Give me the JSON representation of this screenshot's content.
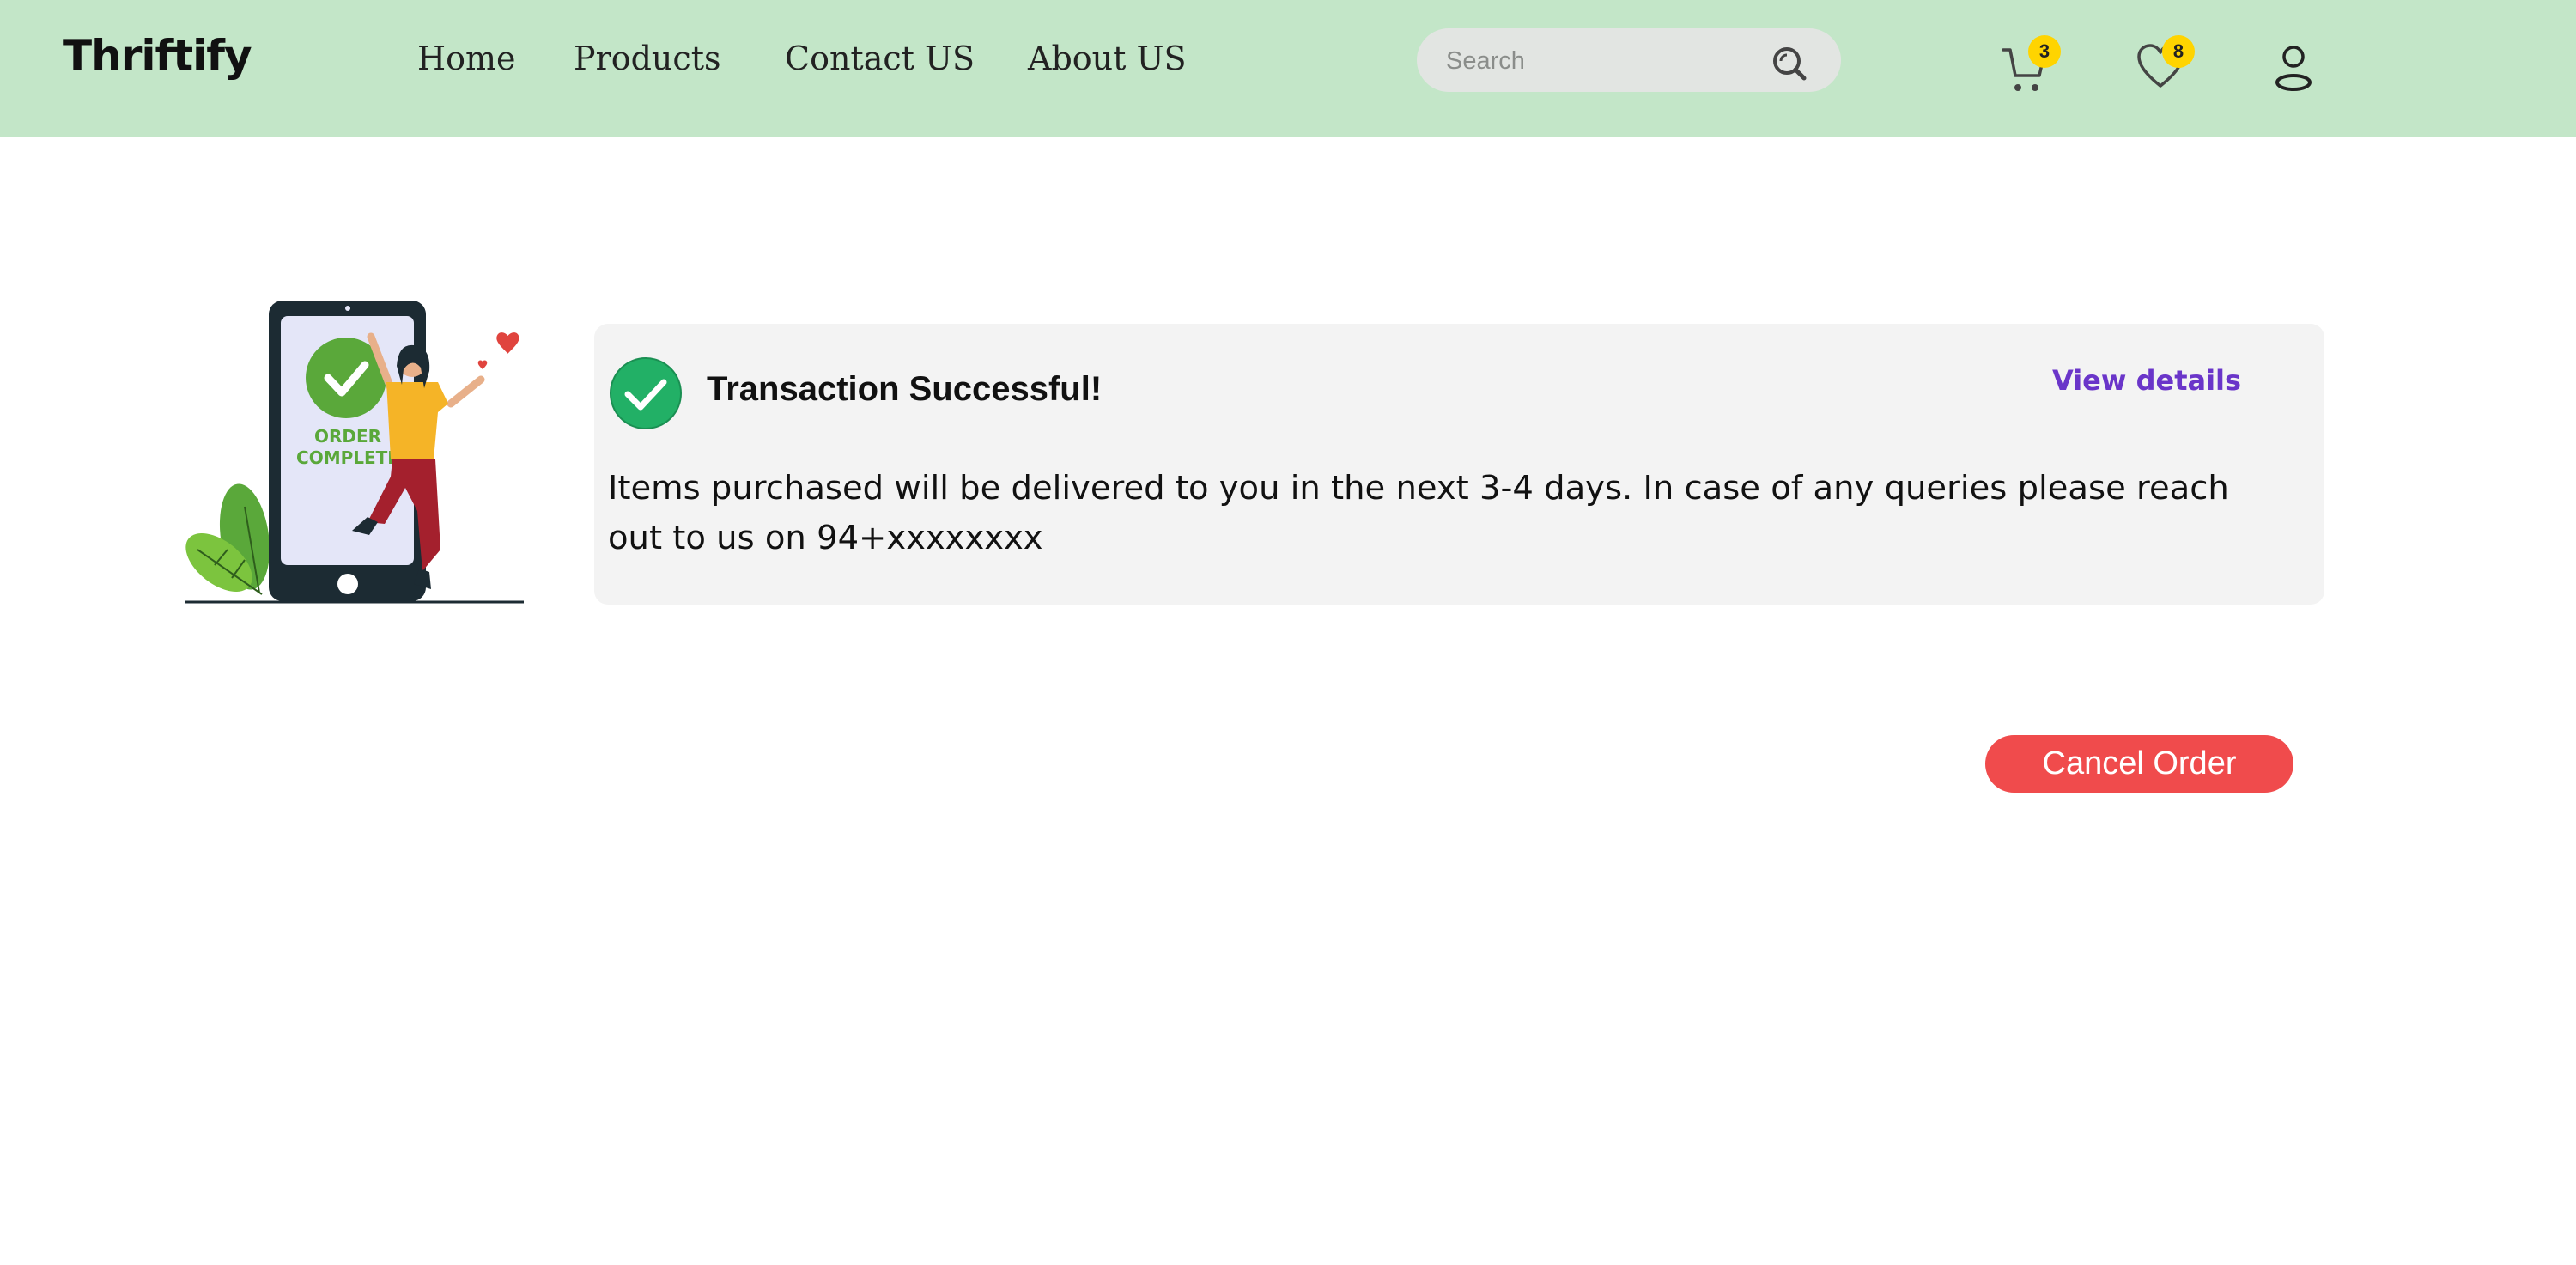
{
  "header": {
    "logo": "Thriftify",
    "nav": [
      "Home",
      "Products",
      "Contact US",
      "About US"
    ],
    "search": {
      "placeholder": "Search",
      "value": ""
    },
    "cart_count": "3",
    "wishlist_count": "8"
  },
  "illustration": {
    "line1": "ORDER",
    "line2": "COMPLETE"
  },
  "card": {
    "title": "Transaction Successful!",
    "view_details": "View details",
    "message": "Items purchased will be delivered to you in the next 3-4 days. In case of any queries please reach out to us on 94+xxxxxxxx"
  },
  "cancel_button": "Cancel Order",
  "colors": {
    "header_bg": "#c3e6c8",
    "badge": "#ffd400",
    "success": "#22b066",
    "link": "#6a35c9",
    "cancel": "#f04b4c"
  }
}
